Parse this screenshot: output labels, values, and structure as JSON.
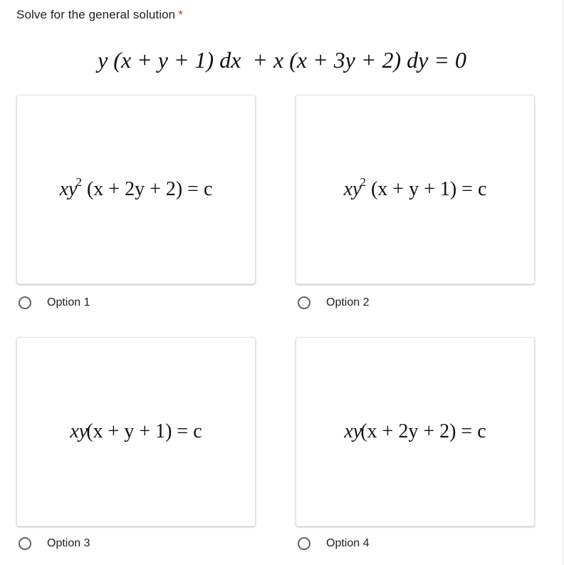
{
  "question": {
    "title": "Solve for the general solution",
    "required_marker": "*",
    "equation": "y (x + y + 1) dx  + x (x + 3y + 2) dy = 0"
  },
  "options": [
    {
      "label": "Option 1",
      "formula_prefix": "xy",
      "formula_exponent": "2",
      "formula_rest": " (x + 2y + 2) = c",
      "selected": false
    },
    {
      "label": "Option 2",
      "formula_prefix": "xy",
      "formula_exponent": "2",
      "formula_rest": " (x + y + 1) = c",
      "selected": false
    },
    {
      "label": "Option 3",
      "formula_prefix": "xy",
      "formula_exponent": "",
      "formula_rest": "(x + y + 1) = c",
      "selected": false
    },
    {
      "label": "Option 4",
      "formula_prefix": "xy",
      "formula_exponent": "",
      "formula_rest": "(x + 2y + 2) = c",
      "selected": false
    }
  ],
  "colors": {
    "required": "#d93025",
    "radio_border": "#5f6368",
    "text": "#202124"
  }
}
